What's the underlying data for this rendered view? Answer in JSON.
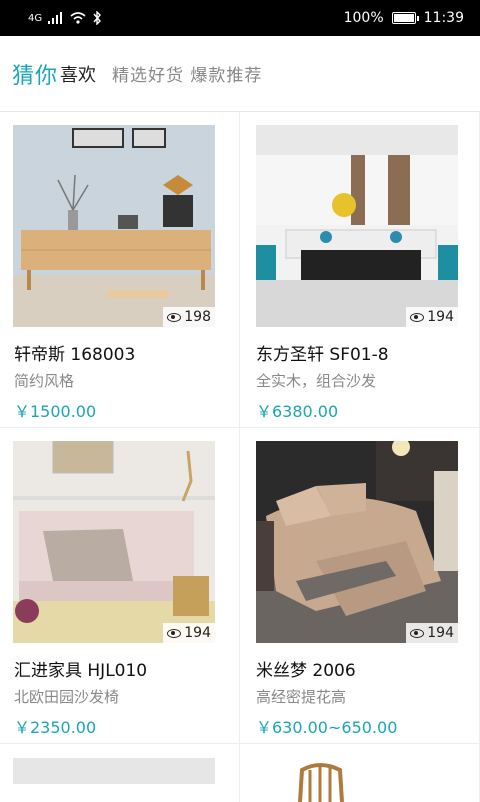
{
  "status": {
    "network": "4G",
    "battery": "100%",
    "time": "11:39"
  },
  "header": {
    "brand": "猜你",
    "brand_suffix": "喜欢",
    "subtitle": "精选好货 爆款推荐"
  },
  "products": [
    {
      "title": "轩帝斯  168003",
      "desc": "简约风格",
      "price": "￥1500.00",
      "views": "198"
    },
    {
      "title": "东方圣轩  SF01-8",
      "desc": "全实木，组合沙发",
      "price": "￥6380.00",
      "views": "194"
    },
    {
      "title": "汇进家具  HJL010",
      "desc": "北欧田园沙发椅",
      "price": "￥2350.00",
      "views": "194"
    },
    {
      "title": "米丝梦  2006",
      "desc": "高经密提花高",
      "price": "￥630.00~650.00",
      "views": "194"
    }
  ],
  "colors": {
    "accent": "#1aa6b7"
  },
  "icons": [
    "signal-icon",
    "wifi-icon",
    "bluetooth-icon",
    "battery-icon",
    "eye-icon"
  ]
}
